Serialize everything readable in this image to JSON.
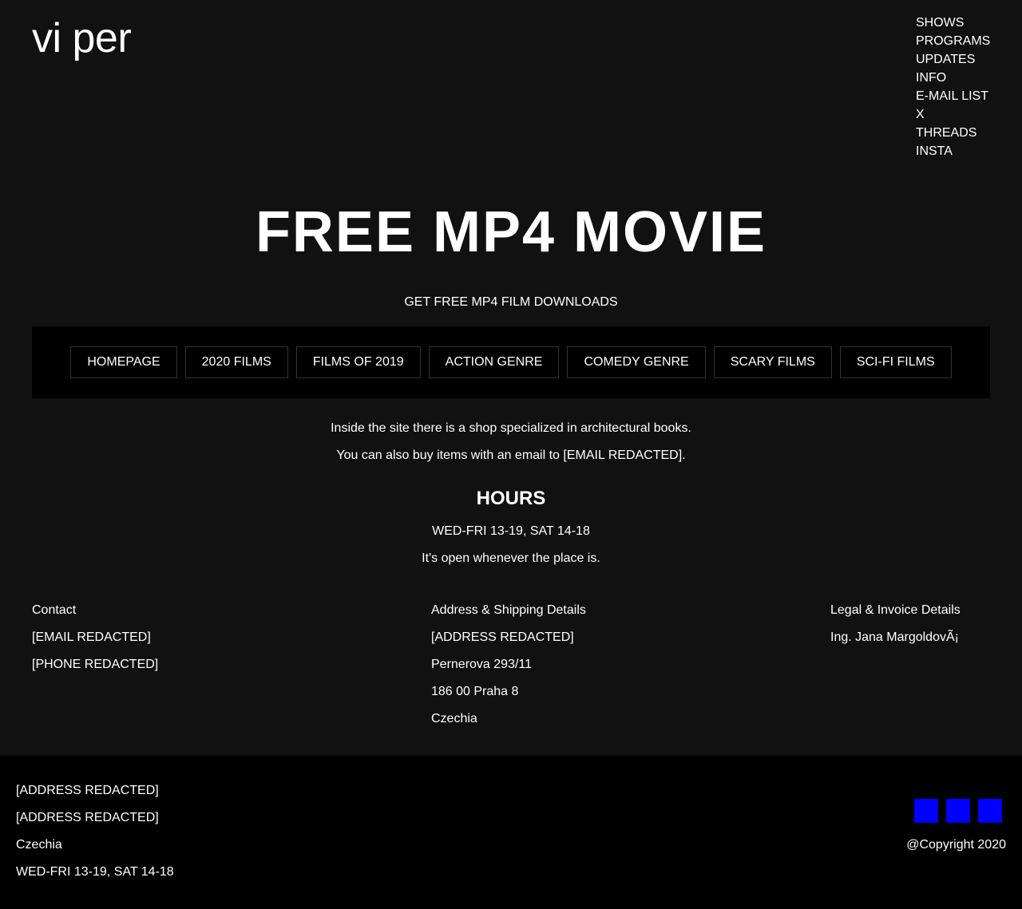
{
  "header": {
    "logo": "vi per",
    "nav": [
      "SHOWS",
      "PROGRAMS",
      "UPDATES",
      "INFO",
      "E-MAIL LIST",
      "X",
      "THREADS",
      "INSTA"
    ]
  },
  "hero": {
    "title": "FREE MP4 MOVIE",
    "subtitle": "GET FREE MP4 FILM DOWNLOADS"
  },
  "menu": [
    "HOMEPAGE",
    "2020 FILMS",
    "FILMS OF 2019",
    "ACTION GENRE",
    "COMEDY GENRE",
    "SCARY FILMS",
    "SCI-FI FILMS"
  ],
  "intro": {
    "line1": "Inside the site there is a shop specialized in architectural books.",
    "line2": "You can also buy items with an email to [EMAIL REDACTED]."
  },
  "hours": {
    "title": "HOURS",
    "times": "WED-FRI 13-19, SAT 14-18",
    "note": "It's open whenever the place is."
  },
  "columns": {
    "contact": [
      "Contact",
      "[EMAIL REDACTED]",
      "[PHONE REDACTED]"
    ],
    "address": [
      "Address & Shipping Details",
      "[ADDRESS REDACTED]",
      "Pernerova 293/11",
      "186 00 Praha 8",
      "Czechia"
    ],
    "legal": [
      "Legal & Invoice Details",
      "Ing. Jana MargoldovÃ¡"
    ]
  },
  "footer": {
    "lines": [
      "[ADDRESS REDACTED]",
      "[ADDRESS REDACTED]",
      "Czechia",
      "WED-FRI 13-19, SAT 14-18"
    ],
    "social_icons": [
      "social-icon-1",
      "social-icon-2",
      "social-icon-3"
    ],
    "social_color": "#0000ff",
    "copyright": "@Copyright 2020"
  }
}
